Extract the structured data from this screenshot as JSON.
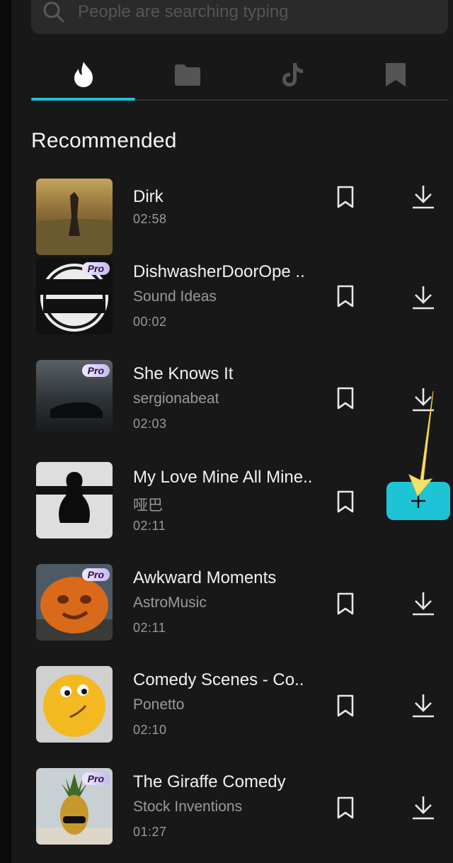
{
  "search": {
    "placeholder": "People are searching typing",
    "icon": "search-icon"
  },
  "tabs": [
    {
      "icon": "flame-icon",
      "active": true
    },
    {
      "icon": "folder-icon",
      "active": false
    },
    {
      "icon": "tiktok-icon",
      "active": false
    },
    {
      "icon": "bookmark-icon",
      "active": false
    }
  ],
  "colors": {
    "accent": "#20c1d6",
    "add_button": "#1dc4d6",
    "background": "#181818",
    "pro_badge": "#e8dcff",
    "arrow": "#f5e06a"
  },
  "section": {
    "title": "Recommended"
  },
  "tracks": [
    {
      "title": "Dirk",
      "artist": "",
      "duration": "02:58",
      "pro": false
    },
    {
      "title": "DishwasherDoorOpe ..",
      "artist": "Sound Ideas",
      "duration": "00:02",
      "pro": true,
      "pro_label": "Pro"
    },
    {
      "title": "She Knows It",
      "artist": "sergionabeat",
      "duration": "02:03",
      "pro": true,
      "pro_label": "Pro"
    },
    {
      "title": "My Love Mine All Mine..",
      "artist": "哑巴",
      "duration": "02:11",
      "pro": false,
      "selected": true,
      "add_label": "+"
    },
    {
      "title": "Awkward Moments",
      "artist": "AstroMusic",
      "duration": "02:11",
      "pro": true,
      "pro_label": "Pro"
    },
    {
      "title": "Comedy Scenes - Co..",
      "artist": "Ponetto",
      "duration": "02:10",
      "pro": false
    },
    {
      "title": "The Giraffe Comedy",
      "artist": "Stock Inventions",
      "duration": "01:27",
      "pro": true,
      "pro_label": "Pro"
    }
  ]
}
